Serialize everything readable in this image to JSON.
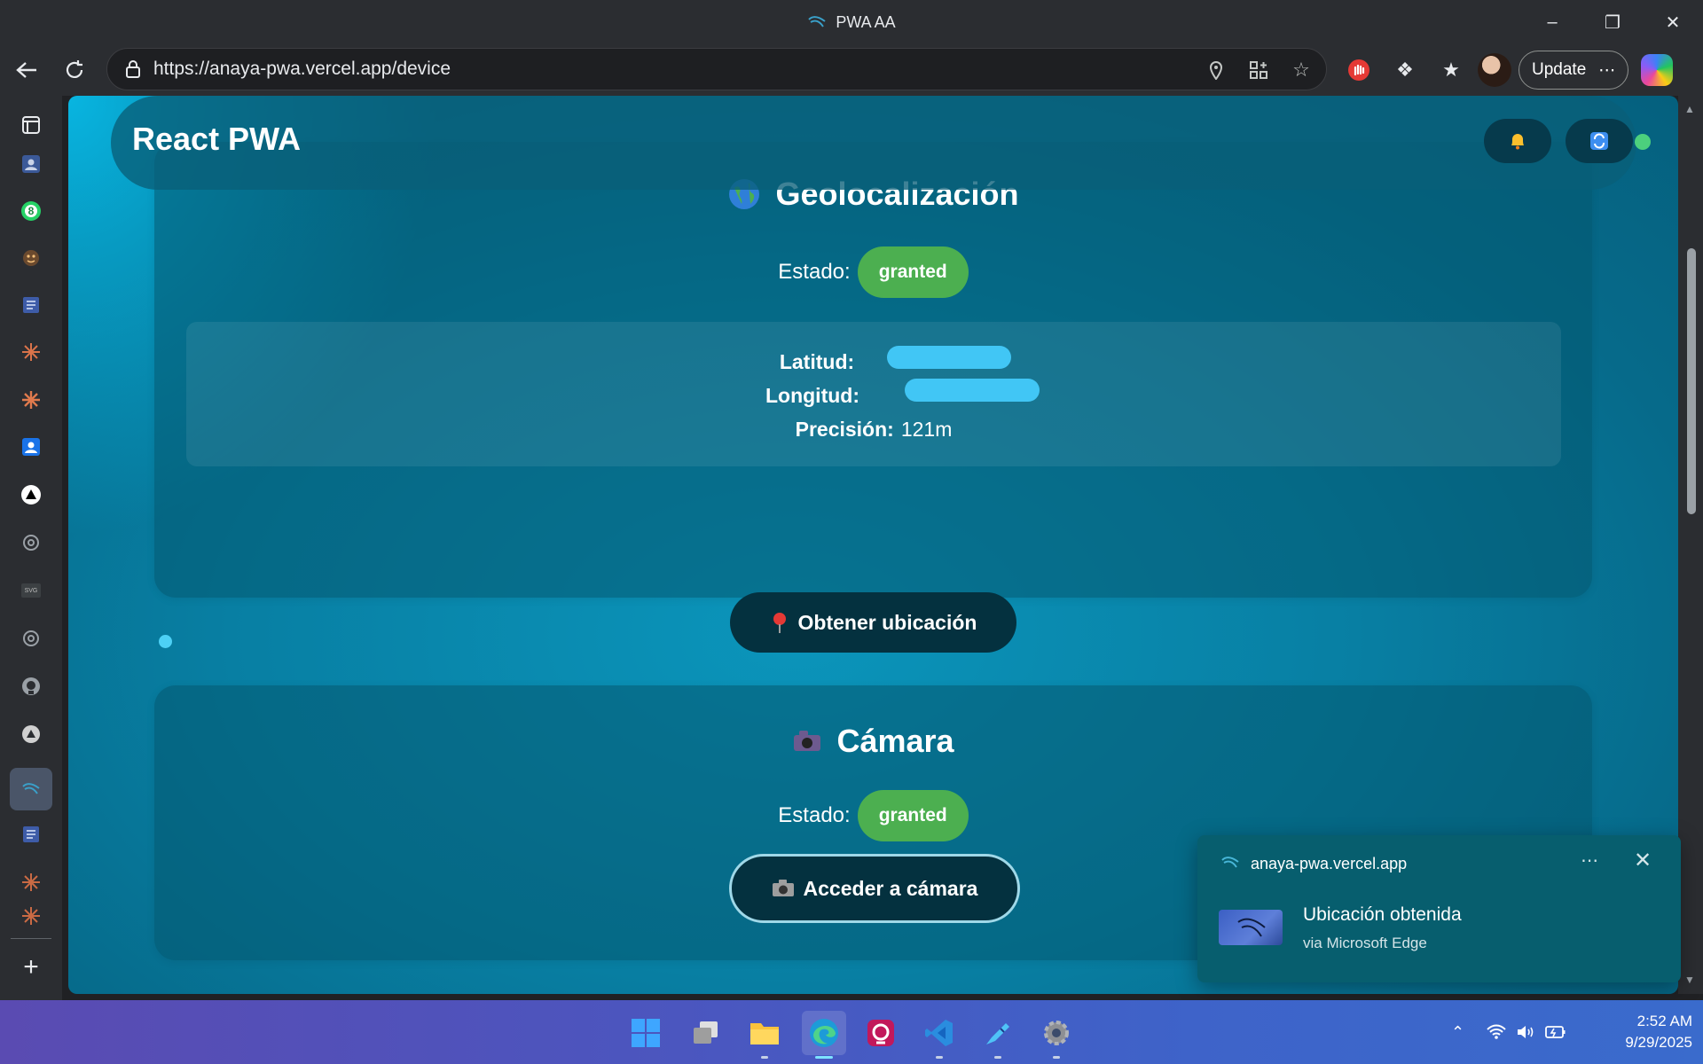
{
  "window": {
    "title": "PWA AA"
  },
  "toolbar": {
    "url": "https://anaya-pwa.vercel.app/device",
    "update_label": "Update"
  },
  "app": {
    "brand": "React PWA"
  },
  "geolocation": {
    "title": "Geolocalización",
    "estado_label": "Estado:",
    "estado_value": "granted",
    "lat_label": "Latitud:",
    "lon_label": "Longitud:",
    "precision_label": "Precisión:",
    "precision_value": "121m",
    "button_label": "Obtener ubicación"
  },
  "camera": {
    "title": "Cámara",
    "estado_label": "Estado:",
    "estado_value": "granted",
    "button_label": "Acceder a cámara"
  },
  "notification": {
    "origin": "anaya-pwa.vercel.app",
    "heading": "Ubicación obtenida",
    "subtext": "via Microsoft Edge"
  },
  "taskbar": {
    "time": "2:52 AM",
    "date": "9/29/2025"
  },
  "sidebar": {
    "whatsapp_badge": "8"
  },
  "colors": {
    "page_accent": "#087fa3",
    "badge_green": "#4caf50",
    "button_dark": "#04313f",
    "toast_bg": "#075e6e"
  },
  "icons": {
    "geo": "globe-icon",
    "pin": "pin-icon",
    "camera": "camera-icon",
    "bell": "bell-icon",
    "refresh": "refresh-icon",
    "status": "online-status-icon"
  }
}
